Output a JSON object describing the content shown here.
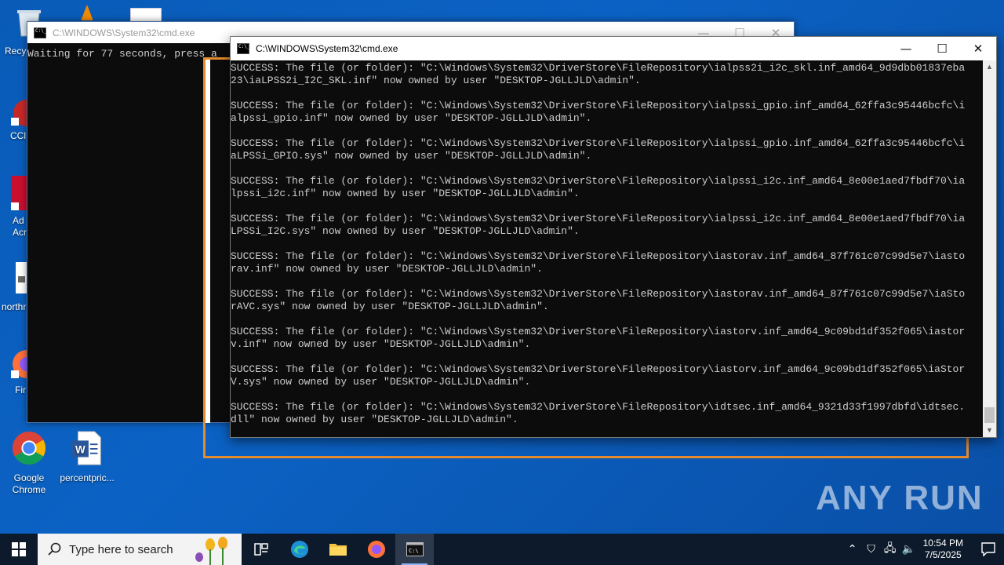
{
  "desktop": {
    "icons": [
      {
        "label": "Recy"
      },
      {
        "label": "CCl"
      },
      {
        "label": "Ad\nAcr"
      },
      {
        "label": "northr"
      },
      {
        "label": "Fir"
      },
      {
        "label": "Google Chrome"
      },
      {
        "label": "percentpric..."
      }
    ]
  },
  "back_window": {
    "title": "C:\\WINDOWS\\System32\\cmd.exe",
    "text": "Waiting for 77 seconds, press a"
  },
  "front_window": {
    "title": "C:\\WINDOWS\\System32\\cmd.exe",
    "minimize": "—",
    "maximize": "☐",
    "close": "✕",
    "lines": [
      "SUCCESS: The file (or folder): \"C:\\Windows\\System32\\DriverStore\\FileRepository\\ialpss2i_i2c_skl.inf_amd64_9d9dbb01837eba",
      "23\\iaLPSS2i_I2C_SKL.inf\" now owned by user \"DESKTOP-JGLLJLD\\admin\".",
      "",
      "SUCCESS: The file (or folder): \"C:\\Windows\\System32\\DriverStore\\FileRepository\\ialpssi_gpio.inf_amd64_62ffa3c95446bcfc\\i",
      "alpssi_gpio.inf\" now owned by user \"DESKTOP-JGLLJLD\\admin\".",
      "",
      "SUCCESS: The file (or folder): \"C:\\Windows\\System32\\DriverStore\\FileRepository\\ialpssi_gpio.inf_amd64_62ffa3c95446bcfc\\i",
      "aLPSSi_GPIO.sys\" now owned by user \"DESKTOP-JGLLJLD\\admin\".",
      "",
      "SUCCESS: The file (or folder): \"C:\\Windows\\System32\\DriverStore\\FileRepository\\ialpssi_i2c.inf_amd64_8e00e1aed7fbdf70\\ia",
      "lpssi_i2c.inf\" now owned by user \"DESKTOP-JGLLJLD\\admin\".",
      "",
      "SUCCESS: The file (or folder): \"C:\\Windows\\System32\\DriverStore\\FileRepository\\ialpssi_i2c.inf_amd64_8e00e1aed7fbdf70\\ia",
      "LPSSi_I2C.sys\" now owned by user \"DESKTOP-JGLLJLD\\admin\".",
      "",
      "SUCCESS: The file (or folder): \"C:\\Windows\\System32\\DriverStore\\FileRepository\\iastorav.inf_amd64_87f761c07c99d5e7\\iasto",
      "rav.inf\" now owned by user \"DESKTOP-JGLLJLD\\admin\".",
      "",
      "SUCCESS: The file (or folder): \"C:\\Windows\\System32\\DriverStore\\FileRepository\\iastorav.inf_amd64_87f761c07c99d5e7\\iaSto",
      "rAVC.sys\" now owned by user \"DESKTOP-JGLLJLD\\admin\".",
      "",
      "SUCCESS: The file (or folder): \"C:\\Windows\\System32\\DriverStore\\FileRepository\\iastorv.inf_amd64_9c09bd1df352f065\\iastor",
      "v.inf\" now owned by user \"DESKTOP-JGLLJLD\\admin\".",
      "",
      "SUCCESS: The file (or folder): \"C:\\Windows\\System32\\DriverStore\\FileRepository\\iastorv.inf_amd64_9c09bd1df352f065\\iaStor",
      "V.sys\" now owned by user \"DESKTOP-JGLLJLD\\admin\".",
      "",
      "SUCCESS: The file (or folder): \"C:\\Windows\\System32\\DriverStore\\FileRepository\\idtsec.inf_amd64_9321d33f1997dbfd\\idtsec.",
      "dll\" now owned by user \"DESKTOP-JGLLJLD\\admin\"."
    ]
  },
  "taskbar": {
    "search_placeholder": "Type here to search",
    "time": "10:54 PM",
    "date": "7/5/2025"
  },
  "watermark": "ANY RUN"
}
